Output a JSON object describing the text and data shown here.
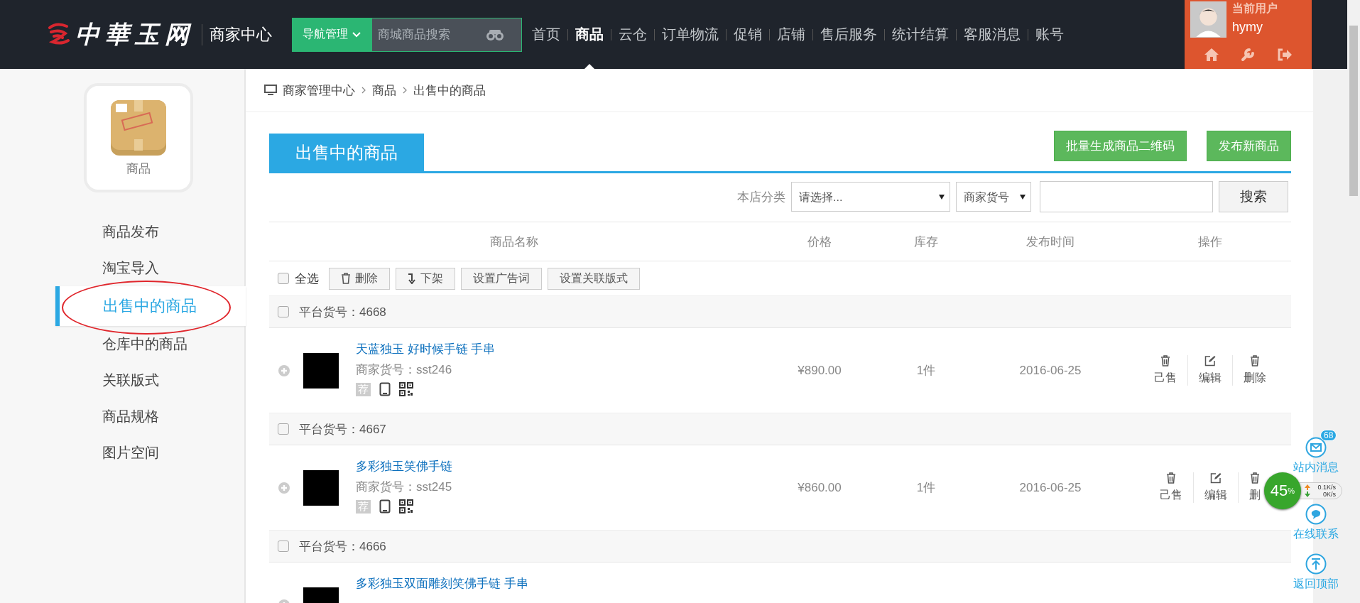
{
  "header": {
    "logo_text": "中華玉网",
    "center_title": "商家中心",
    "nav_button": "导航管理",
    "search": {
      "placeholder": "商城商品搜索"
    },
    "nav": [
      {
        "label": "首页",
        "selected": false
      },
      {
        "label": "商品",
        "selected": true
      },
      {
        "label": "云仓",
        "selected": false
      },
      {
        "label": "订单物流",
        "selected": false
      },
      {
        "label": "促销",
        "selected": false
      },
      {
        "label": "店铺",
        "selected": false
      },
      {
        "label": "售后服务",
        "selected": false
      },
      {
        "label": "统计结算",
        "selected": false
      },
      {
        "label": "客服消息",
        "selected": false
      },
      {
        "label": "账号",
        "selected": false
      }
    ],
    "user": {
      "label": "当前用户",
      "name": "hymy"
    }
  },
  "sidebar": {
    "card_label": "商品",
    "items": [
      {
        "label": "商品发布",
        "selected": false,
        "circled": false
      },
      {
        "label": "淘宝导入",
        "selected": false,
        "circled": false
      },
      {
        "label": "出售中的商品",
        "selected": true,
        "circled": true
      },
      {
        "label": "仓库中的商品",
        "selected": false,
        "circled": false
      },
      {
        "label": "关联版式",
        "selected": false,
        "circled": false
      },
      {
        "label": "商品规格",
        "selected": false,
        "circled": false
      },
      {
        "label": "图片空间",
        "selected": false,
        "circled": false
      }
    ]
  },
  "breadcrumb": [
    "商家管理中心",
    "商品",
    "出售中的商品"
  ],
  "page_title": "出售中的商品",
  "buttons": [
    "批量生成商品二维码",
    "发布新商品"
  ],
  "filter": {
    "label": "本店分类",
    "category_select": "请选择...",
    "field_select": "商家货号",
    "search_button": "搜索"
  },
  "table": {
    "columns": [
      "商品名称",
      "价格",
      "库存",
      "发布时间",
      "操作"
    ],
    "select_all": {
      "label": "全选",
      "checked": false
    },
    "bulk_actions": [
      {
        "label": "删除",
        "kind": "trash"
      },
      {
        "label": "下架",
        "kind": "down"
      },
      {
        "label": "设置广告词",
        "kind": "plain"
      },
      {
        "label": "设置关联版式",
        "kind": "plain"
      }
    ],
    "groups": [
      {
        "platform_no": "平台货号：4668",
        "checked": false,
        "product": {
          "title": "天蓝独玉 好时候手链 手串",
          "code": "商家货号：sst246",
          "recommend": "荐",
          "price": "¥890.00",
          "stock": "1件",
          "date": "2016-06-25",
          "actions": [
            {
              "label": "己售",
              "kind": "trash"
            },
            {
              "label": "编辑",
              "kind": "edit"
            },
            {
              "label": "删除",
              "kind": "trash"
            }
          ]
        }
      },
      {
        "platform_no": "平台货号：4667",
        "checked": false,
        "product": {
          "title": "多彩独玉笑佛手链",
          "code": "商家货号：sst245",
          "recommend": "荐",
          "price": "¥860.00",
          "stock": "1件",
          "date": "2016-06-25",
          "actions": [
            {
              "label": "己售",
              "kind": "trash"
            },
            {
              "label": "编辑",
              "kind": "edit"
            },
            {
              "label": "删",
              "kind": "trash"
            }
          ]
        }
      },
      {
        "platform_no": "平台货号：4666",
        "checked": false,
        "product": {
          "title": "多彩独玉双面雕刻笑佛手链 手串"
        }
      }
    ]
  },
  "float_bar": [
    {
      "label": "站内消息",
      "kind": "mail",
      "badge": "68"
    },
    {
      "label": "在线联系",
      "kind": "chat"
    },
    {
      "label": "返回顶部",
      "kind": "top"
    }
  ],
  "speed_widget": {
    "percent": "45",
    "unit": "%",
    "up": "0.1K/s",
    "down": "0K/s"
  }
}
